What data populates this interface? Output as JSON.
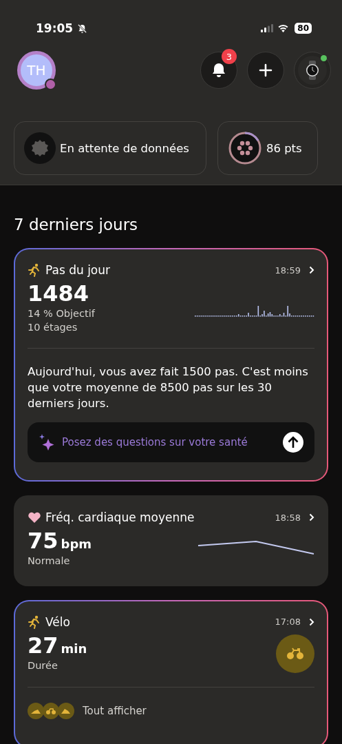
{
  "status_bar": {
    "time": "19:05",
    "battery": "80"
  },
  "header": {
    "avatar": "TH",
    "notifications_badge": "3"
  },
  "chips": [
    {
      "kind": "waiting",
      "label": "En attente de données"
    },
    {
      "kind": "score",
      "label": "86 pts"
    }
  ],
  "section_title": "7 derniers jours",
  "steps_card": {
    "title": "Pas du jour",
    "time": "18:59",
    "value": "1484",
    "goal": "14 % Objectif",
    "floors": "10 étages",
    "summary": "Aujourd'hui, vous avez fait 1500 pas. C'est moins que votre moyenne de 8500 pas sur les 30 derniers jours.",
    "ask_placeholder": "Posez des questions sur votre santé"
  },
  "heart_card": {
    "title": "Fréq. cardiaque moyenne",
    "time": "18:58",
    "value": "75",
    "unit": "bpm",
    "status": "Normale"
  },
  "cycling_card": {
    "title": "Vélo",
    "time": "17:08",
    "value": "27",
    "unit": "min",
    "caption": "Durée",
    "show_all": "Tout afficher"
  }
}
